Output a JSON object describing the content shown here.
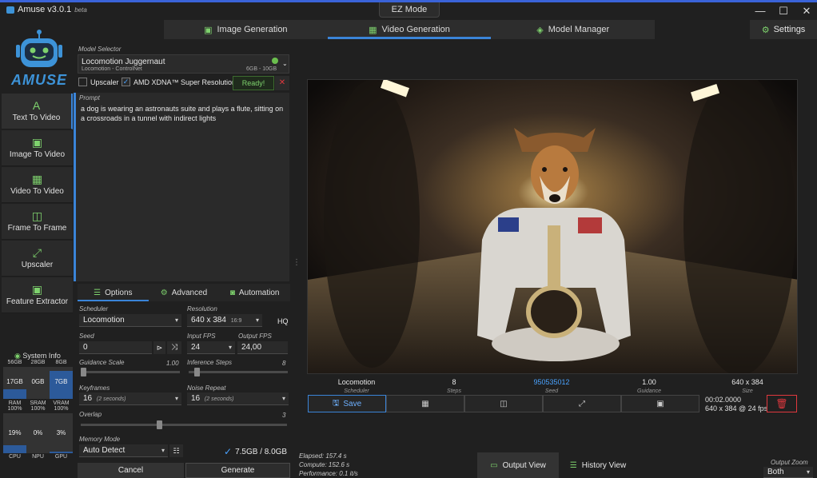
{
  "app": {
    "title": "Amuse v3.0.1",
    "beta": "beta",
    "ez_mode": "EZ Mode",
    "logo_text": "AMUSE"
  },
  "window_controls": {
    "minimize": "—",
    "maximize": "☐",
    "close": "✕"
  },
  "main_tabs": [
    {
      "label": "Image Generation",
      "icon": "image-icon",
      "active": false
    },
    {
      "label": "Video Generation",
      "icon": "film-icon",
      "active": true
    },
    {
      "label": "Model Manager",
      "icon": "layers-icon",
      "active": false
    }
  ],
  "settings": {
    "label": "Settings",
    "icon": "gear-icon"
  },
  "nav": [
    {
      "label": "Text To Video",
      "icon": "text-icon",
      "glyph": "A",
      "active": true
    },
    {
      "label": "Image To Video",
      "icon": "image-icon",
      "glyph": "▣",
      "active": false
    },
    {
      "label": "Video To Video",
      "icon": "film-icon",
      "glyph": "▦",
      "active": false
    },
    {
      "label": "Frame To Frame",
      "icon": "frames-icon",
      "glyph": "◫",
      "active": false
    },
    {
      "label": "Upscaler",
      "icon": "expand-icon",
      "glyph": "⤢",
      "active": false
    },
    {
      "label": "Feature Extractor",
      "icon": "image-icon",
      "glyph": "▣",
      "active": false
    }
  ],
  "system_info": {
    "title": "System Info",
    "columns": [
      {
        "cap": "56GB",
        "value": "17GB",
        "fill": 0.3,
        "name": "RAM",
        "pct": "100%",
        "value2": "19%",
        "fill2": 0.19,
        "name2": "CPU"
      },
      {
        "cap": "28GB",
        "value": "0GB",
        "fill": 0.0,
        "name": "SRAM",
        "pct": "100%",
        "value2": "0%",
        "fill2": 0.0,
        "name2": "NPU"
      },
      {
        "cap": "8GB",
        "value": "7GB",
        "fill": 0.88,
        "name": "VRAM",
        "pct": "100%",
        "value2": "3%",
        "fill2": 0.03,
        "name2": "GPU"
      }
    ]
  },
  "model_selector": {
    "label": "Model Selector",
    "name": "Locomotion Juggernaut",
    "sub": "Locomotion - ControlNet",
    "size": "6GB - 10GB"
  },
  "upscaler": {
    "label": "Upscaler",
    "checked": false
  },
  "super_res": {
    "label": "AMD XDNA™ Super Resolution",
    "checked": true,
    "status": "Ready!"
  },
  "prompt": {
    "label": "Prompt",
    "text": "a dog is wearing an astronauts suite and plays a flute, sitting on a crossroads in a tunnel with indirect lights"
  },
  "sub_tabs": [
    {
      "label": "Options",
      "icon": "sliders-icon",
      "active": true
    },
    {
      "label": "Advanced",
      "icon": "gears-icon",
      "active": false
    },
    {
      "label": "Automation",
      "icon": "robot-icon",
      "active": false
    }
  ],
  "options": {
    "scheduler": {
      "label": "Scheduler",
      "value": "Locomotion"
    },
    "resolution": {
      "label": "Resolution",
      "value": "640 x 384",
      "ratio": "16:9",
      "hq": "HQ"
    },
    "seed": {
      "label": "Seed",
      "value": "0"
    },
    "input_fps": {
      "label": "Input FPS",
      "value": "24"
    },
    "output_fps": {
      "label": "Output FPS",
      "value": "24,00"
    },
    "guidance": {
      "label": "Guidance Scale",
      "value": "1.00",
      "fraction": 0.0
    },
    "inference": {
      "label": "Inference Steps",
      "value": "8",
      "fraction": 0.06
    },
    "keyframes": {
      "label": "Keyframes",
      "value": "16",
      "unit": "(2 seconds)"
    },
    "noise_repeat": {
      "label": "Noise Repeat",
      "value": "16",
      "unit": "(2 seconds)"
    },
    "overlap": {
      "label": "Overlap",
      "value": "3",
      "fraction": 0.38
    },
    "memory_mode": {
      "label": "Memory Mode",
      "value": "Auto Detect"
    },
    "memory_usage": "7.5GB / 8.0GB"
  },
  "actions": {
    "cancel": "Cancel",
    "generate": "Generate"
  },
  "result_meta": [
    {
      "value": "Locomotion",
      "label": "Scheduler",
      "accent": false
    },
    {
      "value": "8",
      "label": "Steps",
      "accent": false
    },
    {
      "value": "950535012",
      "label": "Seed",
      "accent": true
    },
    {
      "value": "1.00",
      "label": "Guidance",
      "accent": false
    },
    {
      "value": "640 x 384",
      "label": "Size",
      "accent": false
    }
  ],
  "result_toolbar": {
    "save": "Save",
    "duration": "00:02.0000",
    "format": "640 x 384 @ 24 fps"
  },
  "stats": {
    "elapsed": "Elapsed: 157.4 s",
    "compute": "Compute: 152.6 s",
    "performance": "Performance: 0.1 it/s"
  },
  "views": {
    "output": "Output View",
    "history": "History View"
  },
  "output_zoom": {
    "label": "Output Zoom",
    "value": "Both"
  },
  "colors": {
    "accent": "#3a84d8",
    "green": "#7ed26d",
    "danger": "#e0383e"
  }
}
